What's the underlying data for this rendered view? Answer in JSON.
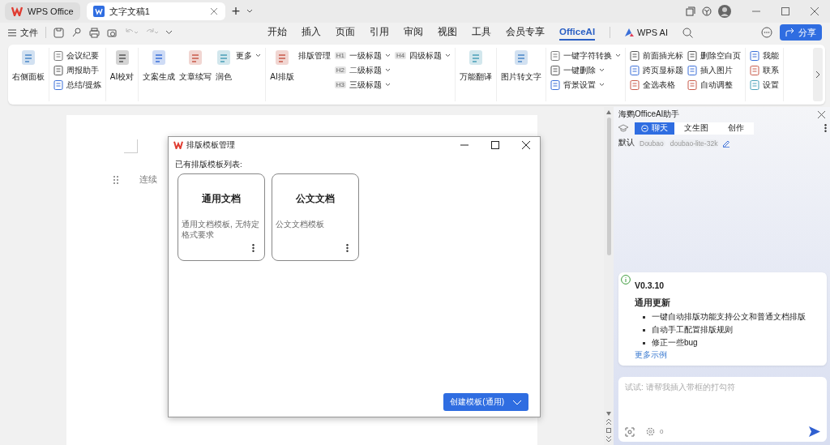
{
  "tabs": [
    {
      "label": "WPS Office",
      "selected": false
    },
    {
      "label": "文字文稿1",
      "selected": true
    }
  ],
  "new_tab": "+",
  "menu": {
    "file": "文件",
    "tabs": [
      {
        "label": "开始",
        "selected": false
      },
      {
        "label": "插入",
        "selected": false
      },
      {
        "label": "页面",
        "selected": false
      },
      {
        "label": "引用",
        "selected": false
      },
      {
        "label": "审阅",
        "selected": false
      },
      {
        "label": "视图",
        "selected": false
      },
      {
        "label": "工具",
        "selected": false
      },
      {
        "label": "会员专享",
        "selected": false
      },
      {
        "label": "OfficeAI",
        "selected": true
      }
    ],
    "wps_ai": "WPS AI",
    "share": "分享"
  },
  "ribbon": [
    {
      "columns": [
        {
          "kind": "large",
          "label": "右侧面板"
        }
      ]
    },
    {
      "columns": [
        {
          "kind": "stack",
          "items": [
            {
              "label": "会议纪要",
              "dropdown": false
            },
            {
              "label": "周报助手",
              "dropdown": false
            },
            {
              "label": "总结/提炼",
              "dropdown": false
            }
          ]
        }
      ]
    },
    {
      "columns": [
        {
          "kind": "large",
          "label": "AI校对"
        }
      ]
    },
    {
      "columns": [
        {
          "kind": "large",
          "label": "文案生成"
        },
        {
          "kind": "large",
          "label": "文章续写"
        },
        {
          "kind": "large",
          "label": "润色"
        },
        {
          "kind": "stack",
          "items": [
            {
              "label": "更多",
              "dropdown": true,
              "plain": true
            }
          ]
        }
      ]
    },
    {
      "columns": [
        {
          "kind": "large",
          "label": "AI排版"
        },
        {
          "kind": "stack",
          "items": [
            {
              "label": "排版管理",
              "dropdown": false,
              "plain": true
            }
          ]
        },
        {
          "kind": "stack",
          "items": [
            {
              "badge": "H1",
              "label": "一级标题",
              "dropdown": true
            },
            {
              "badge": "H2",
              "label": "二级标题",
              "dropdown": true
            },
            {
              "badge": "H3",
              "label": "三级标题",
              "dropdown": true
            }
          ]
        },
        {
          "kind": "stack",
          "items": [
            {
              "badge": "H4",
              "label": "四级标题",
              "dropdown": true
            }
          ]
        }
      ]
    },
    {
      "columns": [
        {
          "kind": "large",
          "label": "万能翻译"
        }
      ]
    },
    {
      "columns": [
        {
          "kind": "large",
          "label": "图片转文字"
        }
      ]
    },
    {
      "columns": [
        {
          "kind": "stack",
          "items": [
            {
              "label": "一键字符转换",
              "dropdown": true
            },
            {
              "label": "一键删除",
              "dropdown": true
            },
            {
              "label": "背景设置",
              "dropdown": true
            }
          ]
        }
      ]
    },
    {
      "columns": [
        {
          "kind": "stack",
          "items": [
            {
              "label": "前面插光标",
              "dropdown": false
            },
            {
              "label": "跨页显标题",
              "dropdown": false
            },
            {
              "label": "全选表格",
              "dropdown": false
            }
          ]
        },
        {
          "kind": "stack",
          "items": [
            {
              "label": "删除空白页",
              "dropdown": false
            },
            {
              "label": "插入图片",
              "dropdown": false
            },
            {
              "label": "自动调整",
              "dropdown": false
            }
          ]
        }
      ]
    },
    {
      "columns": [
        {
          "kind": "stack",
          "items": [
            {
              "label": "我能",
              "dropdown": false
            },
            {
              "label": "联系",
              "dropdown": false
            },
            {
              "label": "设置",
              "dropdown": false
            }
          ]
        }
      ]
    }
  ],
  "document": {
    "text": "连续"
  },
  "dialog": {
    "title": "排版模板管理",
    "list_label": "已有排版模板列表:",
    "cards": [
      {
        "title": "通用文档",
        "description": "通用文档模板, 无特定格式要求"
      },
      {
        "title": "公文文档",
        "description": "公文文档模板"
      }
    ],
    "create_button": "创建模板(通用)"
  },
  "panel": {
    "title": "海鹦OfficeAI助手",
    "tabs": [
      {
        "label": "聊天",
        "selected": true
      },
      {
        "label": "文生图",
        "selected": false
      },
      {
        "label": "创作",
        "selected": false
      }
    ],
    "model": {
      "label": "默认",
      "provider": "Doubao",
      "name": "doubao-lite-32k"
    },
    "update": {
      "version": "V0.3.10",
      "heading": "通用更新",
      "items": [
        "一键自动排版功能支持公文和普通文档排版",
        "自动手工配置排版规则",
        "修正一些bug"
      ],
      "link": "更多示例"
    },
    "input": {
      "placeholder": "试试: 请帮我插入带框的打勾符",
      "count": "0"
    }
  }
}
